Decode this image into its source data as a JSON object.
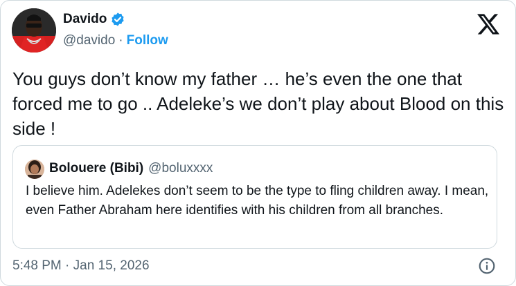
{
  "author": {
    "display_name": "Davido",
    "handle": "@davido",
    "separator": "·",
    "follow_label": "Follow"
  },
  "tweet": {
    "text": "You guys don’t know my father … he’s even the one that forced me to go .. Adeleke’s we don’t play about Blood on this side !"
  },
  "quoted_tweet": {
    "display_name": "Bolouere (Bibi)",
    "handle": "@boluxxxx",
    "text": "I believe him. Adelekes don’t seem to be the type to fling children away. I mean, even Father Abraham here identifies with his children from all branches."
  },
  "footer": {
    "timestamp": "5:48 PM · Jan 15, 2026"
  },
  "icons": {
    "verified": "verified-badge-icon",
    "logo": "x-logo-icon",
    "info": "info-icon"
  },
  "colors": {
    "accent": "#1d9bf0",
    "text_primary": "#0f1419",
    "text_secondary": "#536471",
    "border": "#cfd9de"
  }
}
